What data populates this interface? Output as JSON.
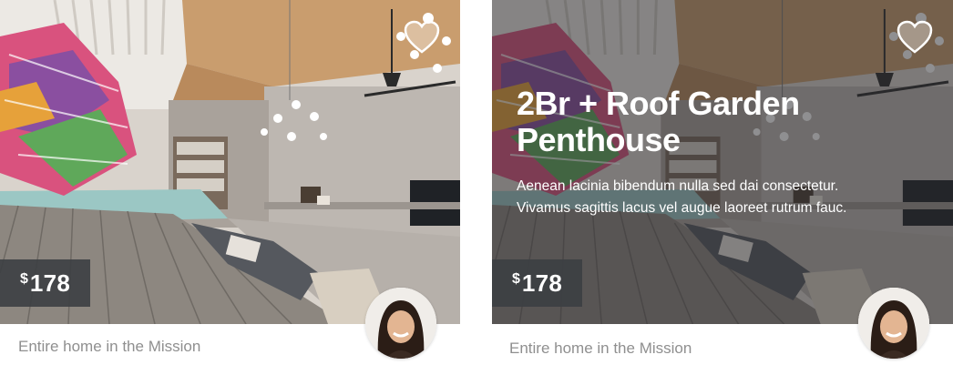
{
  "cards": [
    {
      "price_currency": "$",
      "price_amount": "178",
      "subtitle": "Entire home in the Mission",
      "favorite_icon": "heart-icon",
      "state": "default"
    },
    {
      "price_currency": "$",
      "price_amount": "178",
      "subtitle": "Entire home in the Mission",
      "favorite_icon": "heart-icon",
      "state": "hover",
      "title": "2Br + Roof Garden Penthouse",
      "description_line1": "Aenean lacinia bibendum nulla sed dai consectetur.",
      "description_line2": "Vivamus sagittis lacus vel augue laoreet rutrum fauc."
    }
  ],
  "colors": {
    "price_badge_bg": "#3c3f42",
    "subtitle_text": "#8f8f8f",
    "overlay": "rgba(40,40,45,0.52)"
  }
}
